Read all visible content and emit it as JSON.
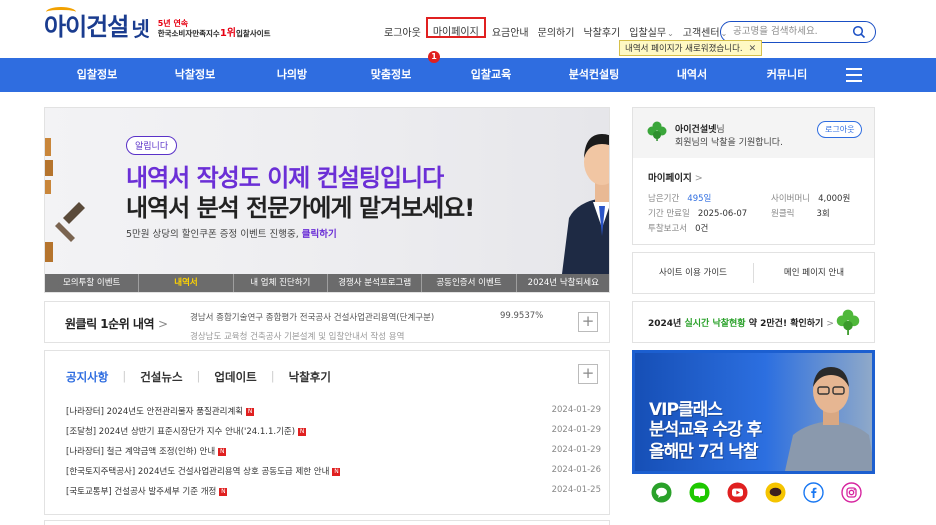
{
  "header": {
    "logo_text": "아이건설",
    "logo_net": "넷",
    "badge_top": "5년 연속",
    "badge_bottom_pre": "한국소비자만족지수",
    "badge_bottom_rank": "1위",
    "badge_bottom_post": "입찰사이트",
    "top_menu": [
      "로그아웃",
      "마이페이지",
      "요금안내",
      "문의하기",
      "낙찰후기",
      "입찰실무",
      "고객센터"
    ],
    "highlight_badge": "1",
    "tooltip_text": "내역서 페이지가 새로워졌습니다.",
    "tooltip_close": "✕",
    "search_placeholder": "공고명을 검색하세요."
  },
  "nav": {
    "items": [
      "입찰정보",
      "낙찰정보",
      "나의방",
      "맞춤정보",
      "입찰교육",
      "분석컨설팅",
      "내역서",
      "커뮤니티"
    ]
  },
  "banner": {
    "pill": "알립니다",
    "headline1": "내역서 작성도 이제 컨설팅입니다",
    "headline2": "내역서 분석 전문가에게 맡겨보세요!",
    "sub": "5만원 상당의 할인쿠폰 증정 이벤트 진행중,",
    "sub_link": "클릭하기",
    "tabs": [
      "모의투찰 이벤트",
      "내역서",
      "내 업체 진단하기",
      "경쟁사 분석프로그램",
      "공동인증서 이벤트",
      "2024년 낙찰되세요"
    ]
  },
  "oneclick": {
    "title": "원클릭 1순위 내역",
    "line1": "경남서 종합기술연구 종합평가 전국공사 건설사업관리용역(단계구분)",
    "pct": "99.9537%",
    "line2": "경상남도 교육청 건축공사 기본설계 및 입찰안내서 작성 용역"
  },
  "news": {
    "tabs": [
      "공지사항",
      "건설뉴스",
      "업데이트",
      "낙찰후기"
    ],
    "rows": [
      {
        "title": "[나라장터] 2024년도 안전관리물자 품질관리계획",
        "date": "2024-01-29"
      },
      {
        "title": "[조달청] 2024년 상반기 표준시장단가 지수 안내('24.1.1.기준)",
        "date": "2024-01-29"
      },
      {
        "title": "[나라장터] 철근 계약금액 조정(인하) 안내",
        "date": "2024-01-29"
      },
      {
        "title": "[한국토지주택공사] 2024년도 건설사업관리용역 상호 공동도급 제한 안내",
        "date": "2024-01-26"
      },
      {
        "title": "[국토교통부] 건설공사 발주세부 기준 개정",
        "date": "2024-01-25"
      }
    ],
    "new_label": "N"
  },
  "profile": {
    "name": "아이건설넷",
    "name_suffix": "님",
    "greeting": "회원님의 낙찰을 기원합니다.",
    "logout": "로그아웃",
    "mypage": "마이페이지",
    "stats": [
      {
        "label": "남은기간",
        "value": "495일"
      },
      {
        "label": "기간 만료일",
        "value": "2025-06-07"
      },
      {
        "label": "투찰보고서",
        "value": "0건"
      },
      {
        "label": "사이버머니",
        "value": "4,000원"
      },
      {
        "label": "원클릭",
        "value": "3회"
      }
    ]
  },
  "guide": {
    "left": "사이트 이용 가이드",
    "right": "메인 페이지 안내"
  },
  "live": {
    "prefix": "2024년",
    "green": "실시간 낙찰현황",
    "suffix": "약 2만건! 확인하기"
  },
  "vip": {
    "line1": "VIP클래스",
    "line2": "분석교육 수강 후",
    "line3": "올해만 7건 낙찰"
  },
  "social": {
    "icons": [
      "wechat-icon",
      "naver-blog-icon",
      "youtube-icon",
      "kakaotalk-icon",
      "facebook-icon",
      "instagram-icon"
    ],
    "colors": [
      "#2aa12a",
      "#1ec800",
      "#e02020",
      "#f5c400",
      "#1877f2",
      "#d6249f"
    ]
  },
  "colors": {
    "nav_blue": "#2f6de0",
    "accent_purple": "#6b2fd6",
    "highlight_red": "#e02020",
    "tooltip_yellow": "#fff9c4"
  }
}
